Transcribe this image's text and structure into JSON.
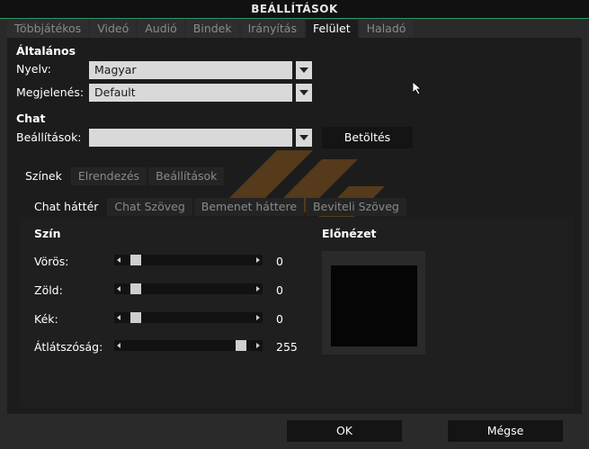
{
  "window": {
    "title": "BEÁLLÍTÁSOK"
  },
  "main_tabs": [
    {
      "label": "Többjátékos",
      "active": false
    },
    {
      "label": "Videó",
      "active": false
    },
    {
      "label": "Audió",
      "active": false
    },
    {
      "label": "Bindek",
      "active": false
    },
    {
      "label": "Irányítás",
      "active": false
    },
    {
      "label": "Felület",
      "active": true
    },
    {
      "label": "Haladó",
      "active": false
    }
  ],
  "general": {
    "heading": "Általános",
    "language_label": "Nyelv:",
    "language_value": "Magyar",
    "appearance_label": "Megjelenés:",
    "appearance_value": "Default"
  },
  "chat": {
    "heading": "Chat",
    "settings_label": "Beállítások:",
    "settings_value": "",
    "load_button": "Betöltés"
  },
  "sub_tabs": [
    {
      "label": "Színek",
      "active": true
    },
    {
      "label": "Elrendezés",
      "active": false
    },
    {
      "label": "Beállítások",
      "active": false
    }
  ],
  "color_tabs": [
    {
      "label": "Chat háttér",
      "active": true
    },
    {
      "label": "Chat Szöveg",
      "active": false
    },
    {
      "label": "Bemenet háttere",
      "active": false
    },
    {
      "label": "Beviteli Szöveg",
      "active": false
    }
  ],
  "color": {
    "heading": "Szín",
    "sliders": [
      {
        "label": "Vörös:",
        "value": "0",
        "level": 0
      },
      {
        "label": "Zöld:",
        "value": "0",
        "level": 0
      },
      {
        "label": "Kék:",
        "value": "0",
        "level": 0
      },
      {
        "label": "Átlátszóság:",
        "value": "255",
        "level": 1
      }
    ]
  },
  "preview": {
    "heading": "Előnézet"
  },
  "footer": {
    "ok_label": "OK",
    "cancel_label": "Mégse"
  },
  "colors": {
    "accent": "#2f9a6a",
    "watermark": "#e88a1a",
    "dropdown_bg": "#d9d9d9"
  },
  "icons": [
    "chevron-down-icon",
    "arrow-left-icon",
    "arrow-right-icon",
    "mouse-cursor-icon",
    "logo-watermark"
  ]
}
